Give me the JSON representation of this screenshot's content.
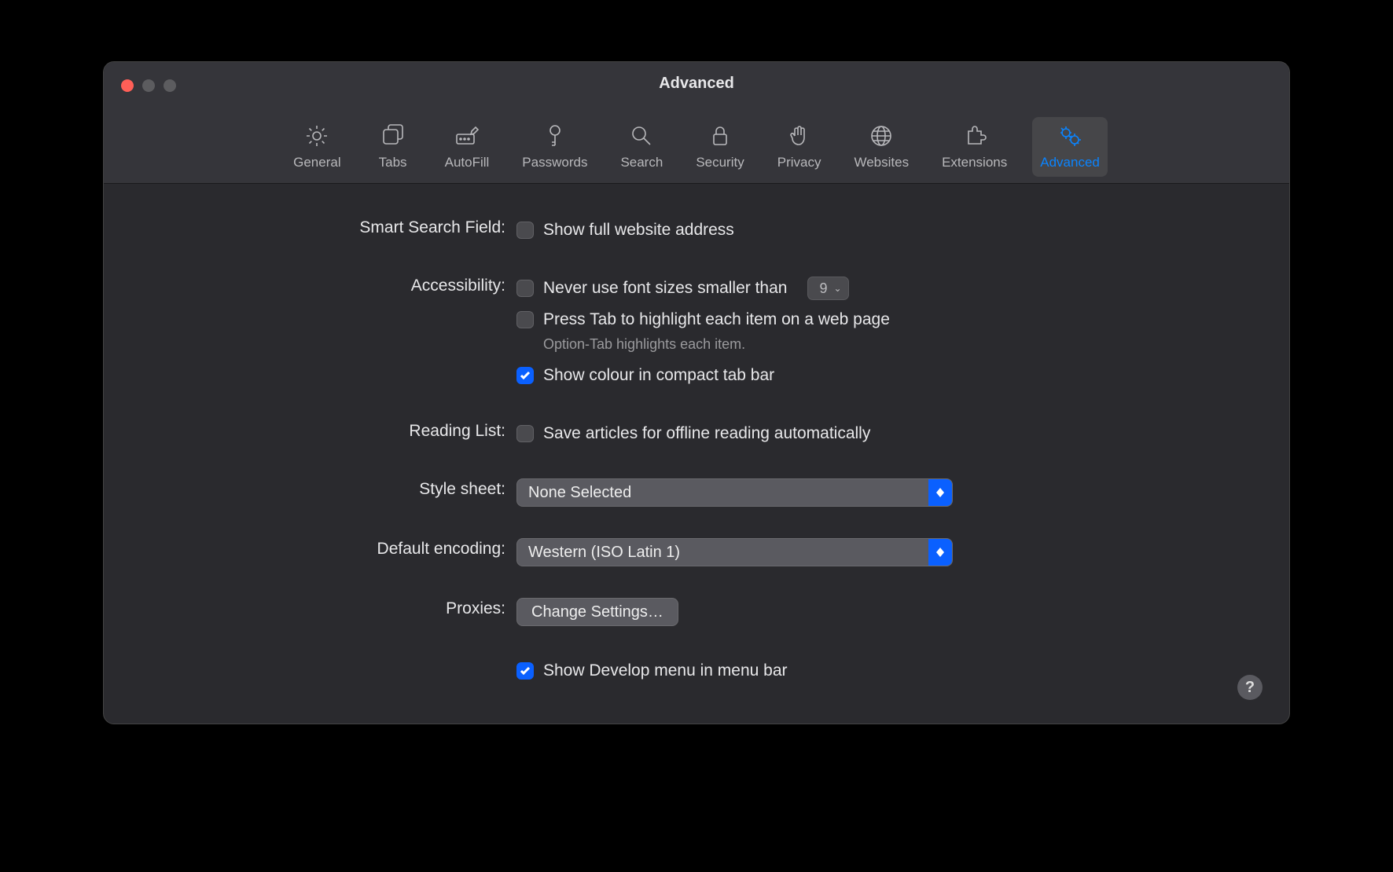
{
  "window": {
    "title": "Advanced"
  },
  "toolbar": {
    "items": [
      {
        "label": "General"
      },
      {
        "label": "Tabs"
      },
      {
        "label": "AutoFill"
      },
      {
        "label": "Passwords"
      },
      {
        "label": "Search"
      },
      {
        "label": "Security"
      },
      {
        "label": "Privacy"
      },
      {
        "label": "Websites"
      },
      {
        "label": "Extensions"
      },
      {
        "label": "Advanced"
      }
    ]
  },
  "sections": {
    "smart_search": {
      "label": "Smart Search Field:",
      "show_full_address": "Show full website address"
    },
    "accessibility": {
      "label": "Accessibility:",
      "never_smaller": "Never use font sizes smaller than",
      "min_font_value": "9",
      "press_tab": "Press Tab to highlight each item on a web page",
      "hint": "Option-Tab highlights each item.",
      "show_colour": "Show colour in compact tab bar"
    },
    "reading_list": {
      "label": "Reading List:",
      "save_offline": "Save articles for offline reading automatically"
    },
    "style_sheet": {
      "label": "Style sheet:",
      "value": "None Selected"
    },
    "default_encoding": {
      "label": "Default encoding:",
      "value": "Western (ISO Latin 1)"
    },
    "proxies": {
      "label": "Proxies:",
      "button": "Change Settings…"
    },
    "develop": {
      "label": "Show Develop menu in menu bar"
    }
  },
  "help": "?"
}
